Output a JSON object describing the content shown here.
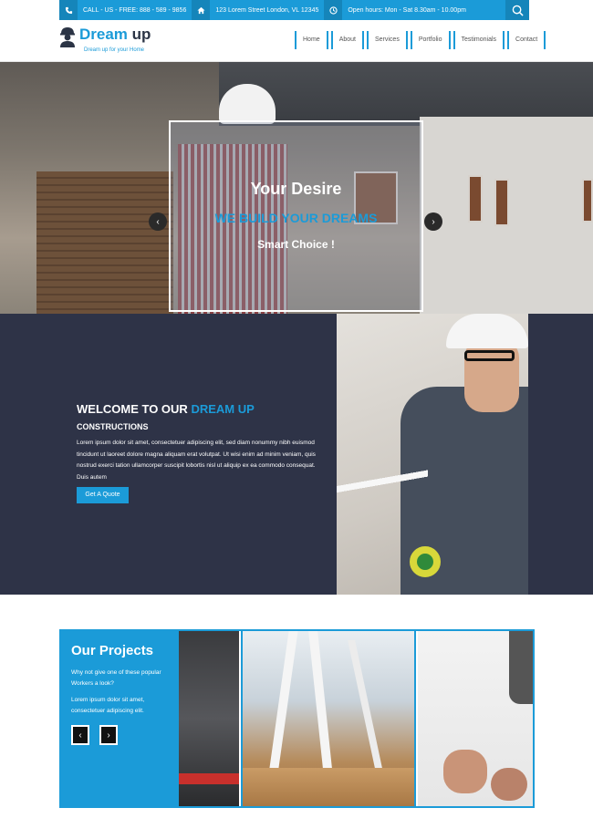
{
  "topbar": {
    "phone": "CALL - US - FREE: 888 - 589 - 9856",
    "address": "123 Lorem Street London, VL 12345",
    "hours": "Open hours: Mon - Sat 8.30am - 10.00pm",
    "icons": [
      "phone-icon",
      "home-icon",
      "clock-icon",
      "search-icon"
    ]
  },
  "header": {
    "logo_part1": "Dream",
    "logo_part2": " up",
    "tagline": "Dream up for your Home",
    "nav": [
      "Home",
      "About",
      "Services",
      "Portfolio",
      "Testimonials",
      "Contact"
    ]
  },
  "hero": {
    "title": "Your Desire",
    "subtitle": "WE BUILD YOUR DREAMS",
    "tagline": "Smart Choice !",
    "prev_icon": "‹",
    "next_icon": "›"
  },
  "welcome": {
    "title_prefix": "WELCOME TO OUR ",
    "title_highlight": "DREAM UP",
    "subtitle": "CONSTRUCTIONS",
    "body": "Lorem ipsum dolor sit amet, consectetuer adipiscing elit, sed diam nonummy nibh euismod tincidunt ut laoreet dolore magna aliquam erat volutpat. Ut wisi enim ad minim veniam, quis nostrud exerci tation ullamcorper suscipit lobortis nisl ut aliquip ex ea commodo consequat. Duis autem",
    "button": "Get A Quote"
  },
  "projects": {
    "title": "Our Projects",
    "question": "Why not give one of these popular Workers a look?",
    "description": "Lorem ipsum dolor sit amet, consectetuer adipiscing elit.",
    "prev_icon": "‹",
    "next_icon": "›"
  },
  "colors": {
    "accent": "#1b9bd8",
    "dark": "#2e3347"
  }
}
